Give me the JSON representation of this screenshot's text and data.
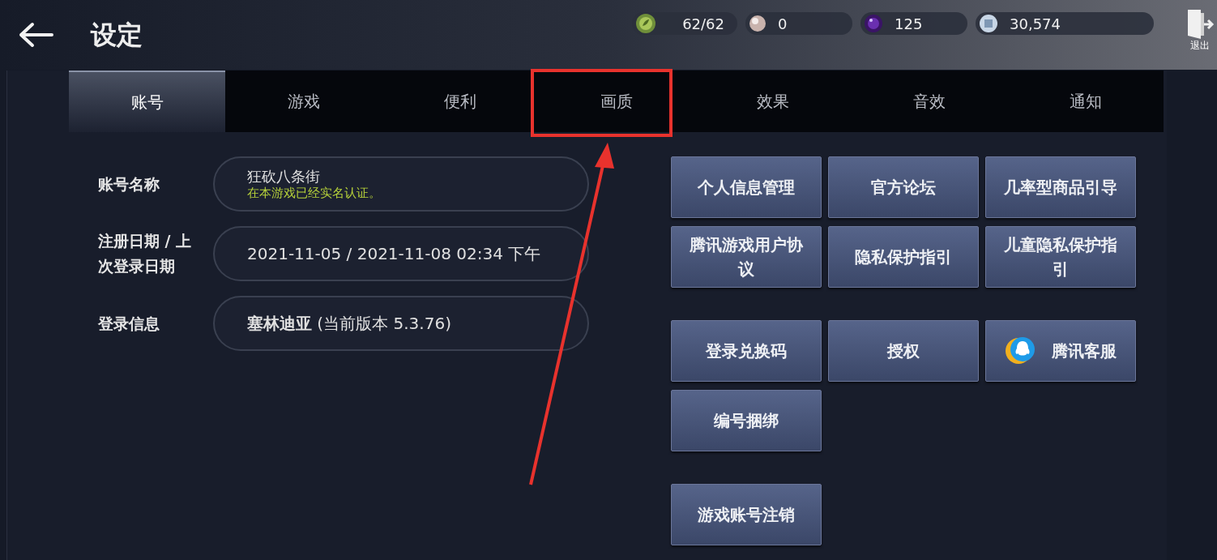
{
  "header": {
    "title": "设定",
    "currencies": [
      {
        "kind": "leaf",
        "value": "62/62"
      },
      {
        "kind": "pearl",
        "value": "0"
      },
      {
        "kind": "orb",
        "value": "125"
      },
      {
        "kind": "coin",
        "value": "30,574"
      }
    ],
    "exit_label": "退出"
  },
  "tabs": [
    {
      "label": "账号",
      "selected": true
    },
    {
      "label": "游戏",
      "selected": false
    },
    {
      "label": "便利",
      "selected": false
    },
    {
      "label": "画质",
      "selected": false
    },
    {
      "label": "效果",
      "selected": false
    },
    {
      "label": "音效",
      "selected": false
    },
    {
      "label": "通知",
      "selected": false
    }
  ],
  "account": [
    {
      "label": "账号名称",
      "value": "狂砍八条街",
      "note": "在本游戏已经实名认证。"
    },
    {
      "label": "注册日期 / 上次登录日期",
      "value": "2021-11-05 / 2021-11-08  02:34 下午"
    },
    {
      "label": "登录信息",
      "value": "**塞林迪亚** (当前版本 5.3.76)"
    }
  ],
  "button_groups": [
    [
      {
        "label": "个人信息管理"
      },
      {
        "label": "官方论坛"
      },
      {
        "label": "几率型商品引导"
      },
      {
        "label": "腾讯游戏用户协议"
      },
      {
        "label": "隐私保护指引"
      },
      {
        "label": "儿童隐私保护指引"
      }
    ],
    [
      {
        "label": "登录兑换码"
      },
      {
        "label": "授权"
      },
      {
        "label": "腾讯客服",
        "kind": "chat"
      },
      {
        "label": "编号捆绑"
      }
    ],
    [
      {
        "label": "游戏账号注销"
      }
    ]
  ]
}
